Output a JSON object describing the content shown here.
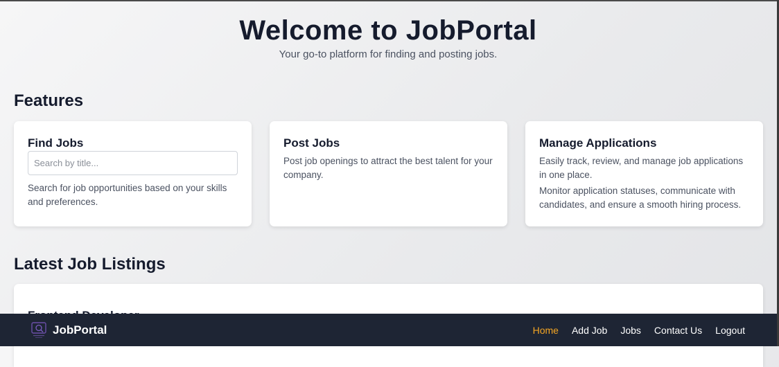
{
  "hero": {
    "title": "Welcome to JobPortal",
    "subtitle": "Your go-to platform for finding and posting jobs."
  },
  "features": {
    "title": "Features",
    "cards": [
      {
        "title": "Find Jobs",
        "search_placeholder": "Search by title...",
        "description": "Search for job opportunities based on your skills and preferences."
      },
      {
        "title": "Post Jobs",
        "description": "Post job openings to attract the best talent for your company."
      },
      {
        "title": "Manage Applications",
        "description": "Easily track, review, and manage job applications in one place.",
        "description2": "Monitor application statuses, communicate with candidates, and ensure a smooth hiring process."
      }
    ]
  },
  "listings": {
    "title": "Latest Job Listings",
    "first_title": "Frontend Developer"
  },
  "navbar": {
    "brand": "JobPortal",
    "logo_icon": "portal-logo-icon",
    "links": [
      {
        "label": "Home",
        "active": true
      },
      {
        "label": "Add Job"
      },
      {
        "label": "Jobs"
      },
      {
        "label": "Contact Us"
      },
      {
        "label": "Logout"
      }
    ],
    "active_color": "#f5a623",
    "background": "#1e2534"
  }
}
